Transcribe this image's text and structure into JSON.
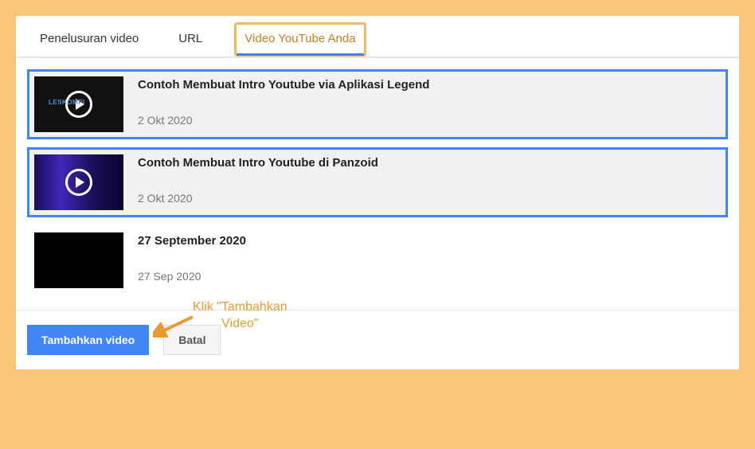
{
  "tabs": {
    "search": "Penelusuran video",
    "url": "URL",
    "yours": "Video YouTube Anda"
  },
  "videos": [
    {
      "title": "Contoh Membuat Intro Youtube via Aplikasi Legend",
      "date": "2 Okt 2020",
      "thumbLabel": "LESKOMPI"
    },
    {
      "title": "Contoh Membuat Intro Youtube di Panzoid",
      "date": "2 Okt 2020",
      "thumbLabel": ""
    },
    {
      "title": "27 September 2020",
      "date": "27 Sep 2020",
      "thumbLabel": ""
    }
  ],
  "buttons": {
    "add": "Tambahkan video",
    "cancel": "Batal"
  },
  "annotation": "Klik \"Tambahkan\nVideo\""
}
